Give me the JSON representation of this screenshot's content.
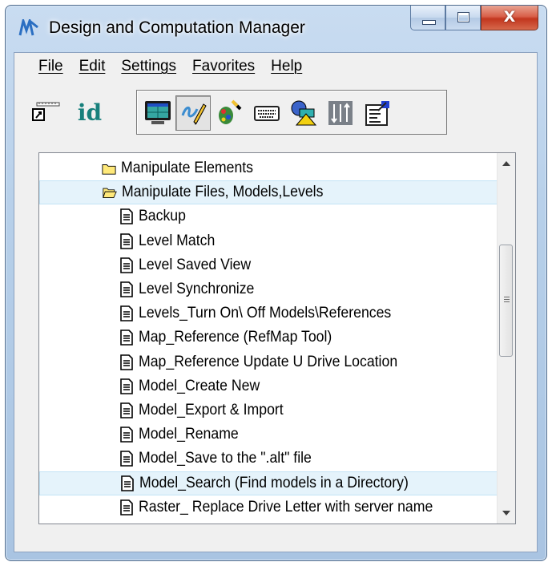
{
  "window": {
    "title": "Design and Computation Manager",
    "close_glyph": "X"
  },
  "menu": {
    "items": [
      "File",
      "Edit",
      "Settings",
      "Favorites",
      "Help"
    ]
  },
  "toolbar": {
    "id_label": "id",
    "buttons": [
      "ruler-icon",
      "id-icon",
      "monitor-icon",
      "pencil-script-icon",
      "palette-icon",
      "keyboard-icon",
      "shapes-icon",
      "levels-icon",
      "properties-icon"
    ],
    "pressed": "pencil-script-icon"
  },
  "list": {
    "items": [
      {
        "label": "Manipulate Elements",
        "type": "folder-closed",
        "indent": 0
      },
      {
        "label": "Manipulate Files, Models,Levels",
        "type": "folder-open",
        "indent": 0,
        "selected": true
      },
      {
        "label": "Backup",
        "type": "document",
        "indent": 1
      },
      {
        "label": "Level Match",
        "type": "document",
        "indent": 1
      },
      {
        "label": "Level Saved View",
        "type": "document",
        "indent": 1
      },
      {
        "label": "Level Synchronize",
        "type": "document",
        "indent": 1
      },
      {
        "label": "Levels_Turn On\\ Off Models\\References",
        "type": "document",
        "indent": 1
      },
      {
        "label": "Map_Reference (RefMap Tool)",
        "type": "document",
        "indent": 1
      },
      {
        "label": "Map_Reference Update U Drive Location",
        "type": "document",
        "indent": 1
      },
      {
        "label": "Model_Create New",
        "type": "document",
        "indent": 1
      },
      {
        "label": "Model_Export & Import",
        "type": "document",
        "indent": 1
      },
      {
        "label": "Model_Rename",
        "type": "document",
        "indent": 1
      },
      {
        "label": "Model_Save to the \".alt\" file",
        "type": "document",
        "indent": 1
      },
      {
        "label": "Model_Search (Find models in a Directory)",
        "type": "document",
        "indent": 1,
        "selected": true
      },
      {
        "label": "Raster_ Replace Drive Letter with server name",
        "type": "document",
        "indent": 1
      }
    ]
  },
  "colors": {
    "selection_bg": "#e5f3fb",
    "folder": "#ffe97a",
    "id_teal": "#17807c"
  }
}
